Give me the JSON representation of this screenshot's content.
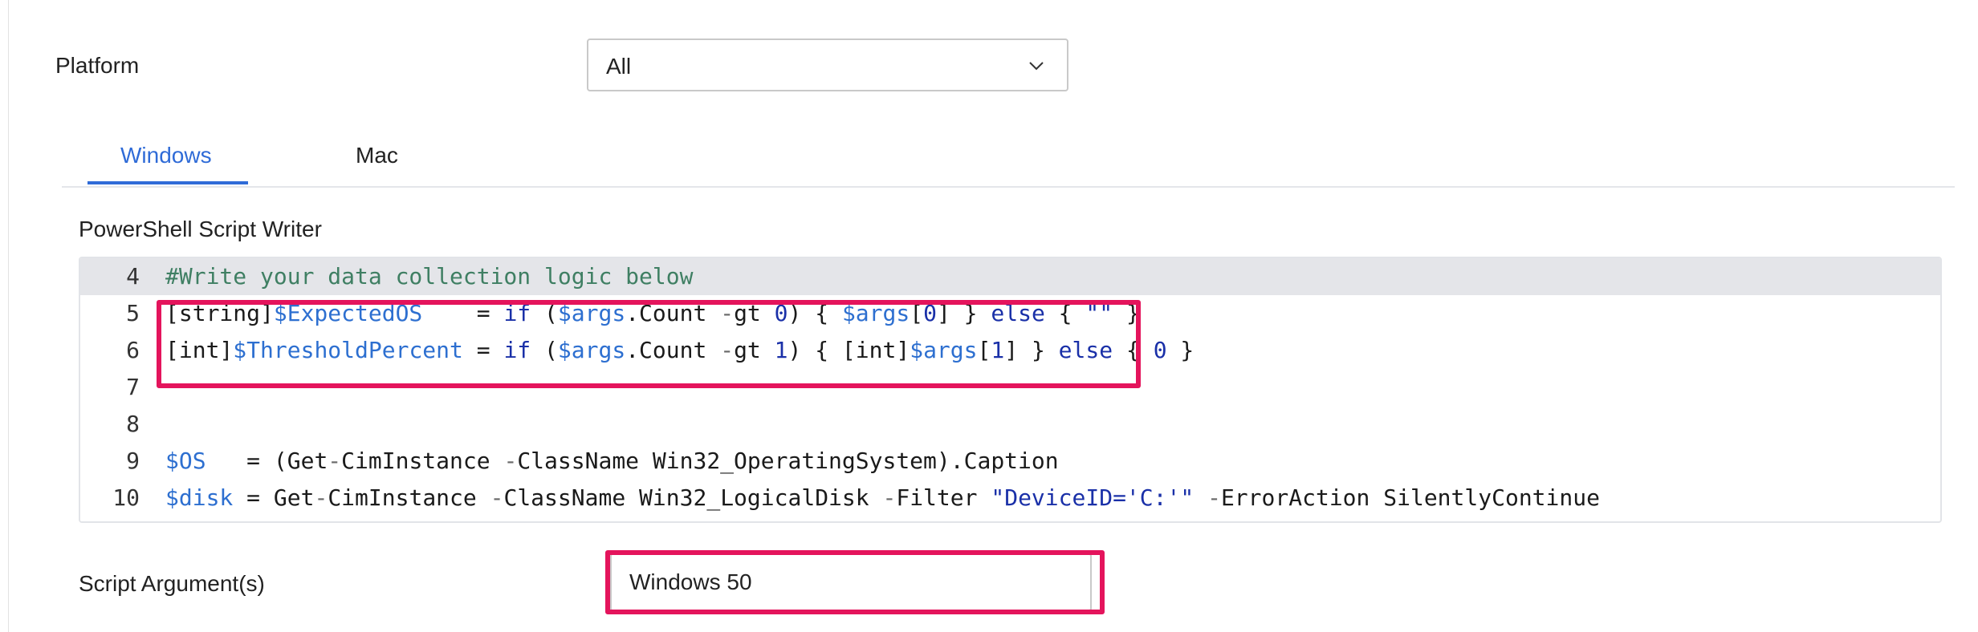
{
  "platform": {
    "label": "Platform",
    "selected": "All",
    "chevron_icon": "chevron-down-icon"
  },
  "tabs": [
    {
      "label": "Windows",
      "active": true
    },
    {
      "label": "Mac",
      "active": false
    }
  ],
  "script_writer": {
    "label": "PowerShell Script Writer",
    "lines": [
      {
        "number": "4",
        "text": "#Write your data collection logic below"
      },
      {
        "number": "5",
        "text": "[string]$ExpectedOS    = if ($args.Count -gt 0) { $args[0] } else { \"\" }"
      },
      {
        "number": "6",
        "text": "[int]$ThresholdPercent = if ($args.Count -gt 1) { [int]$args[1] } else { 0 }"
      },
      {
        "number": "7",
        "text": ""
      },
      {
        "number": "8",
        "text": ""
      },
      {
        "number": "9",
        "text": "$OS   = (Get-CimInstance -ClassName Win32_OperatingSystem).Caption"
      },
      {
        "number": "10",
        "text": "$disk = Get-CimInstance -ClassName Win32_LogicalDisk -Filter \"DeviceID='C:'\" -ErrorAction SilentlyContinue"
      }
    ]
  },
  "script_arguments": {
    "label": "Script Argument(s)",
    "value": "Windows 50"
  },
  "colors": {
    "accent": "#2f6bd7",
    "highlight": "#e4145c",
    "comment": "#3f7f63",
    "variable": "#2d6fd0",
    "keyword": "#1a30a8"
  }
}
